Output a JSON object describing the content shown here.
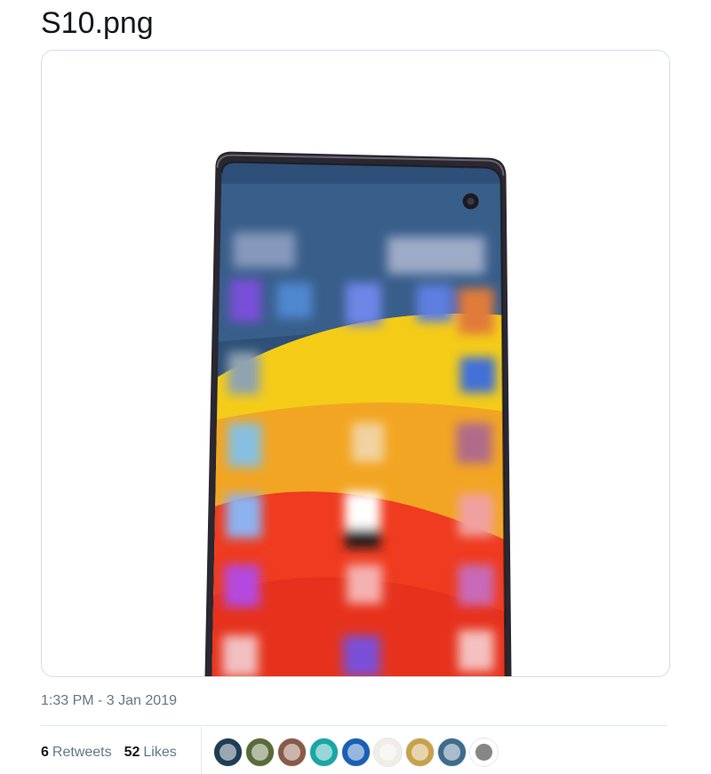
{
  "tweet": {
    "text": "S10.png",
    "timestamp": "1:33 PM - 3 Jan 2019"
  },
  "stats": {
    "retweets_count": "6",
    "retweets_label": "Retweets",
    "likes_count": "52",
    "likes_label": "Likes"
  },
  "avatars": [
    {
      "color": "#1f3d55"
    },
    {
      "color": "#5a6b3a"
    },
    {
      "color": "#8a5a48"
    },
    {
      "color": "#1aa6a6"
    },
    {
      "color": "#1a5fb4"
    },
    {
      "color": "#f1ede6"
    },
    {
      "color": "#c9a14a"
    },
    {
      "color": "#3f6b8c"
    },
    {
      "color": "#ffffff"
    }
  ]
}
